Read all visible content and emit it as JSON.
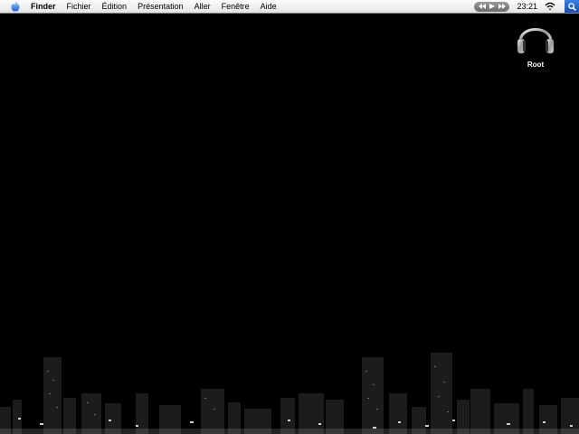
{
  "menubar": {
    "apple_icon": "apple-logo-icon",
    "app_name": "Finder",
    "items": [
      "Fichier",
      "Édition",
      "Présentation",
      "Aller",
      "Fenêtre",
      "Aide"
    ],
    "clock": "23:21",
    "media_controls": [
      "previous-icon",
      "play-icon",
      "next-icon"
    ],
    "wifi_icon": "wifi-icon",
    "spotlight_icon": "spotlight-search-icon"
  },
  "desktop": {
    "icon": {
      "name": "headphones-icon",
      "label": "Root"
    },
    "wallpaper": "city-skyline-night"
  }
}
